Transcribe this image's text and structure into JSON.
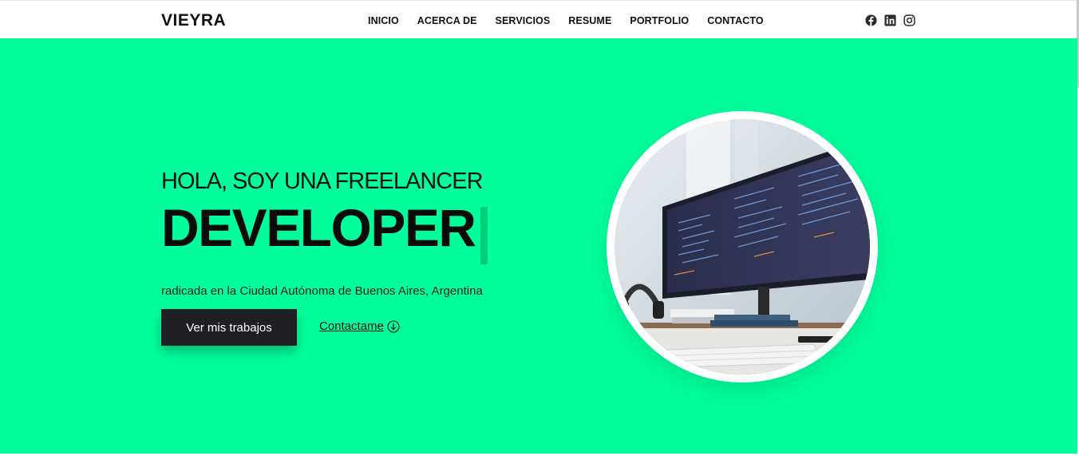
{
  "navbar": {
    "brand": "VIEYRA",
    "links": [
      "INICIO",
      "ACERCA DE",
      "SERVICIOS",
      "RESUME",
      "PORTFOLIO",
      "CONTACTO"
    ],
    "socials": [
      "facebook-icon",
      "linkedin-icon",
      "instagram-icon"
    ]
  },
  "hero": {
    "eyebrow": "HOLA, SOY UNA FREELANCER",
    "title": "DEVELOPER",
    "subtitle": "radicada en la Ciudad Autónoma de Buenos Aires, Argentina",
    "primary_button": "Ver mis trabajos",
    "secondary_link": "Contactame",
    "secondary_icon": "arrow-down-circle-icon",
    "photo": "developer-workstation-image"
  },
  "colors": {
    "accent": "#00ff9c",
    "accent_dark": "#00cf7a",
    "button_bg": "#1f1f24",
    "text": "#111111"
  }
}
